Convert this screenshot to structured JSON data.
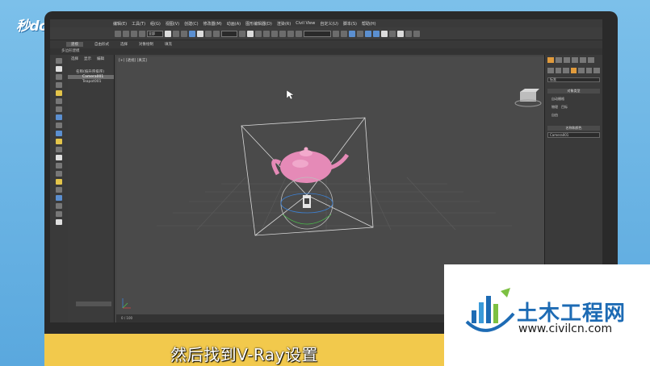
{
  "watermark": {
    "logo_text": "秒dong视频"
  },
  "menu": {
    "items": [
      "编辑(E)",
      "工具(T)",
      "组(G)",
      "视图(V)",
      "创建(C)",
      "修改器(M)",
      "动画(A)",
      "图形编辑器(D)",
      "渲染(R)",
      "Civil View",
      "自定义(U)",
      "脚本(S)",
      "帮助(H)"
    ]
  },
  "toolbar": {
    "select_filter": "全部",
    "named_sel": ""
  },
  "ribbon": {
    "tabs": [
      "建模",
      "自由形式",
      "选择",
      "对象绘制",
      "填充"
    ],
    "active_index": 0,
    "sub_label": "多边形建模"
  },
  "explorer": {
    "tabs": [
      "选择",
      "显示",
      "编辑"
    ],
    "header": "名称(按升序排序)",
    "items": [
      "Camera001",
      "Teapot001"
    ],
    "selected_index": 0
  },
  "viewport": {
    "label": "[+] [透视] [真实]"
  },
  "timeline": {
    "frame": "0 / 100"
  },
  "command_panel": {
    "category": "标准",
    "section_object_type": "对象类型",
    "autogrid": "自动栅格",
    "buttons": [
      "物理",
      "目标",
      "自由"
    ],
    "section_name_color": "名称和颜色",
    "name_value": "Camera001"
  },
  "subtitle": {
    "text": "然后找到V-Ray设置"
  },
  "site": {
    "name": "土木工程网",
    "url": "www.civilcn.com"
  },
  "colors": {
    "teapot": "#e58ab7",
    "accent_yellow": "#f2c94c",
    "site_blue": "#1d6bb4"
  }
}
